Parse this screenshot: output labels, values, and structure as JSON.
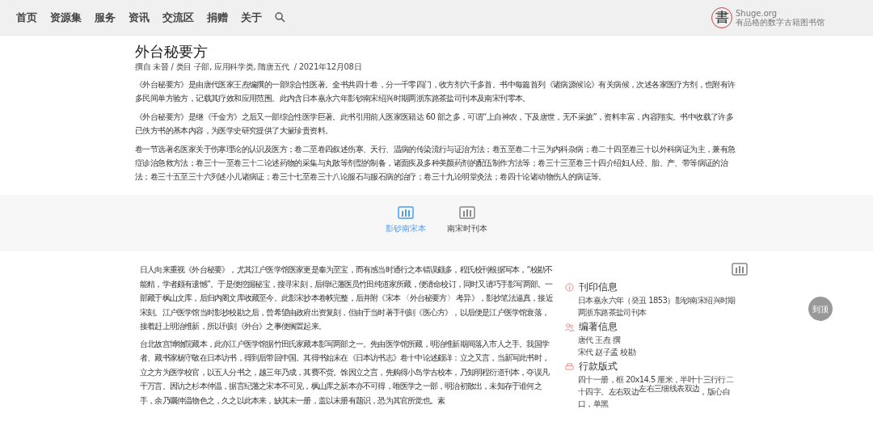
{
  "nav": {
    "items": [
      {
        "label": "首页"
      },
      {
        "label": "资源集"
      },
      {
        "label": "服务"
      },
      {
        "label": "资讯"
      },
      {
        "label": "交流区"
      },
      {
        "label": "捐赠"
      },
      {
        "label": "关于"
      }
    ],
    "logo": {
      "glyph": "書",
      "name": "Shuge.org",
      "tagline": "有品格的数字古籍图书馆"
    }
  },
  "article": {
    "title": "外台秘要方",
    "meta": "撰自 未晉 / 类目 子部, 应用科学类, 隋唐五代  / 2021年12月08日",
    "paragraphs": [
      "《外台秘要方》是由唐代医家王焘编撰的一部综合性医著。全书共四十卷，分一千零四门，收方剂六千多首。书中每篇首列《诸病源候论》有关病候，次述各家医疗方剂，也附有许多民间单方验方，记载其疗效和应用范围。此内含日本嘉永六年影钞南宋绍兴时期两浙东路茶盐司刊本及南宋刊零本。",
      "《外台秘要方》是继《千金方》之后又一部综合性医学巨著。此书引用前人医家医籍达 60 部之多，可谓“上自神农，下及唐世，无不采摭”，资料丰富，内容翔实。书中收载了许多已佚方书的基本内容，为医学史研究提供了大量珍贵资料。",
      "卷一节选著名医家关于伤寒理论的认识及医方；卷二至卷四叙述伤寒、天行、温病的传染流行与证治方法；卷五至卷二十三为内科杂病；卷二十四至卷三十以外科病证为主，兼有急症诊治急救方法；卷三十一至卷三十二论述药物的采集与丸散等剂型的制备，诸面疾及多种美颜药剂的配伍制作方法等；卷三十三至卷三十四介绍妇人经、胎、产、带等病证的治法；卷三十五至三十六列述小儿诸病证；卷三十七至卷三十八论服石与服石病的治疗；卷三十九论明堂灸法；卷四十论诸动物伤人的病证等。"
    ]
  },
  "edition_tabs": [
    {
      "label": "影钞南宋本",
      "selected": true
    },
    {
      "label": "南宋时刊本",
      "selected": false
    }
  ],
  "edition": {
    "paragraphs": [
      "日人向来重视《外台秘要》，尤其江户医学馆医家更是奉为至宝，而有感当时通行之本错误颇多，程氏校刊根据写本，“校勘不能精，学者颇有遗憾”。于是便挖掘秘宝，搜寻宋刻，后得纪藩医员竹田纯道家所藏，便请命校订，同时又请巧手影写两部。一部藏于枫山文库，后归内阁文库收藏至今。此影宋抄本卷帙完整，后并附《宋本 〈外台秘要方〉 考异》，影抄笔法逼真，接近宋刻。江户医学馆当时影抄校勘之后，曾希望由政府出资复刻，但由于当时著手刊刻《医心方》，以后便是江户医学馆衰落，接着赶上明治维新，所以刊刻《外台》之事便搁置起来。",
      "台北故宫博物院藏本，此亦江户医学馆据竹田氏家藏本影写两部之一。先由医学馆所藏，明治维新期间落入市人之手。我国学者、藏书家杨守敬在日本访书，得到后带回中国。其得书始末在《日本访书志》卷十中论述颇详：立之又言，当新写此书时，立之方为医学校官，以五人分书之，越三年乃成，其费不赀。馀因立之言，先购得小岛学古校本，乃知明程衍道刊本，夺误凡千万言。因访之杉本仲温，据言纪藩之宋本不可见，枫山库之新本亦不可得，唯医学之一部，明治初散出，未知存于谁何之手，余乃嘱仲温物色之，久之以此本来，缺其末一册，盖以末册有题识，恐为其官所觉也。素"
    ],
    "info": [
      {
        "kind": "print",
        "heading": "刊印信息",
        "lines": [
          "日本嘉永六年（癸丑 1853）影钞南宋绍兴时期两浙东路茶盐司刊本"
        ]
      },
      {
        "kind": "author",
        "heading": "编著信息",
        "lines": [
          "唐代 王焘 撰",
          "宋代 赵子孟 校勘"
        ]
      },
      {
        "kind": "format",
        "heading": "行款版式",
        "lines": [
          "四十一册，框 20x14.5 厘米，半叶十三行行二十四字。左右双边$^{左右三细线表双边}$，版心白口，单黑"
        ]
      }
    ]
  },
  "back_to_top": {
    "label": "到顶"
  }
}
